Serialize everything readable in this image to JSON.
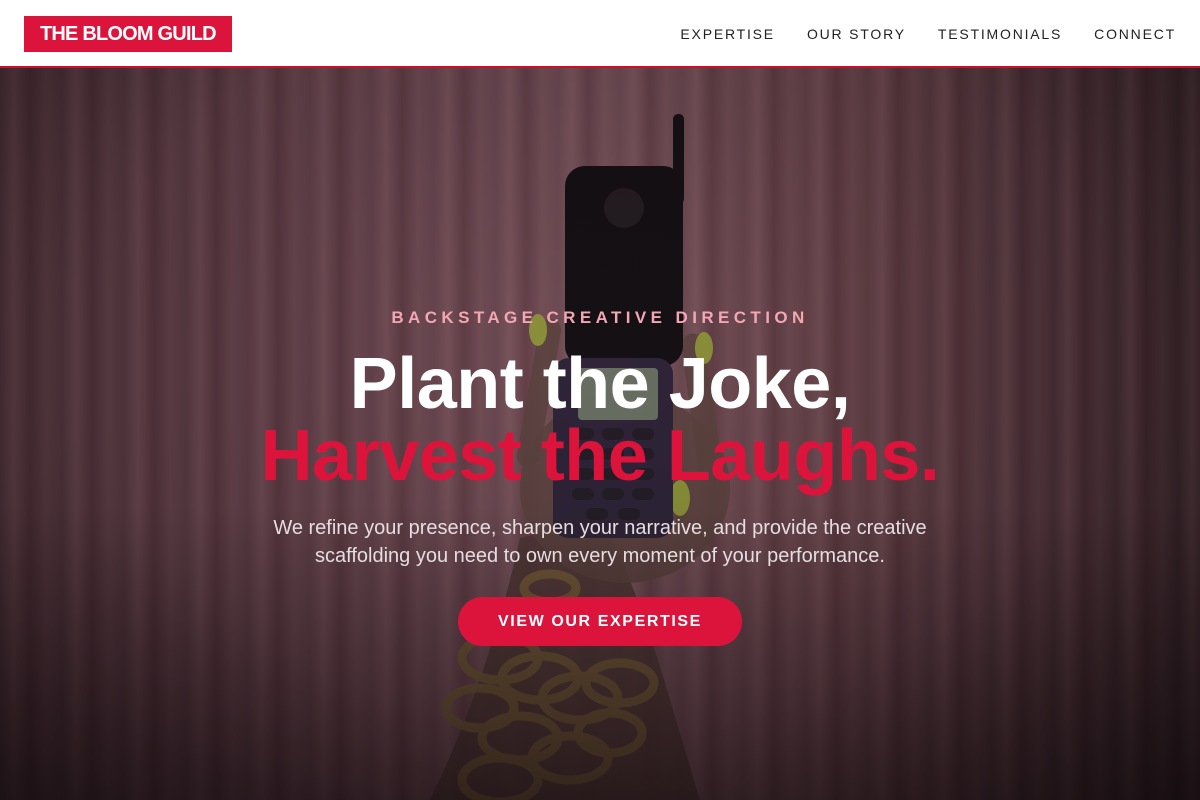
{
  "header": {
    "logo": "THE BLOOM GUILD",
    "nav": [
      {
        "label": "EXPERTISE"
      },
      {
        "label": "OUR STORY"
      },
      {
        "label": "TESTIMONIALS"
      },
      {
        "label": "CONNECT"
      }
    ]
  },
  "hero": {
    "eyebrow": "BACKSTAGE CREATIVE DIRECTION",
    "headline_line1": "Plant the Joke,",
    "headline_line2": "Harvest the Laughs.",
    "subtext": "We refine your presence, sharpen your narrative, and provide the creative scaffolding you need to own every moment of your performance.",
    "cta_label": "VIEW OUR EXPERTISE",
    "background_image": "hand-holding-flip-phone-photo"
  },
  "colors": {
    "accent": "#dc143c",
    "eyebrow": "#f4a6b4",
    "header_bg": "#ffffff",
    "nav_text": "#222222"
  }
}
